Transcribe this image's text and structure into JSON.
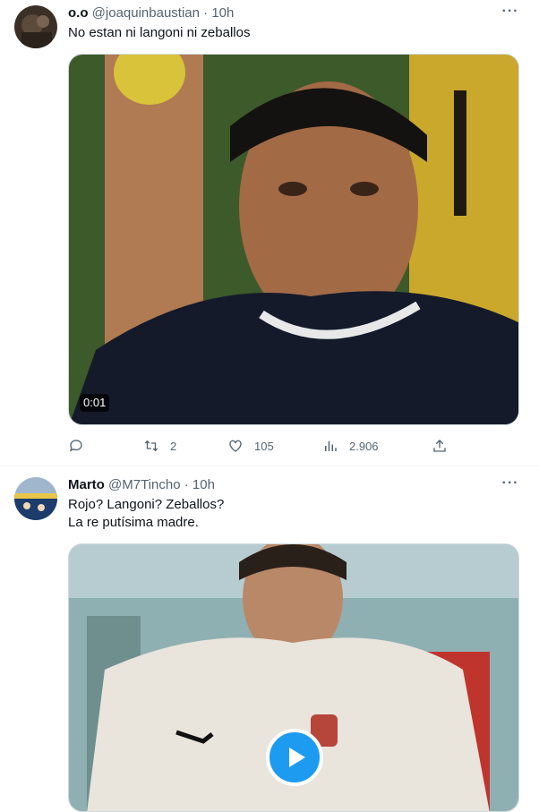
{
  "tweets": [
    {
      "display_name": "o.o",
      "handle": "@joaquinbaustian",
      "separator": "·",
      "time": "10h",
      "text_lines": [
        "No estan ni langoni ni zeballos"
      ],
      "media": {
        "duration": "0:01"
      },
      "stats": {
        "replies": "",
        "retweets": "2",
        "likes": "105",
        "views": "2.906"
      }
    },
    {
      "display_name": "Marto",
      "handle": "@M7Tincho",
      "separator": "·",
      "time": "10h",
      "text_lines": [
        "Rojo? Langoni? Zeballos?",
        "La re putísima madre."
      ]
    }
  ],
  "icons": {
    "more": "more-horizontal-icon",
    "reply": "reply-icon",
    "retweet": "retweet-icon",
    "like": "heart-icon",
    "views": "views-icon",
    "share": "share-icon",
    "play": "play-icon"
  },
  "colors": {
    "accent": "#1d9bf0",
    "muted": "#536471",
    "text": "#0f1419"
  }
}
